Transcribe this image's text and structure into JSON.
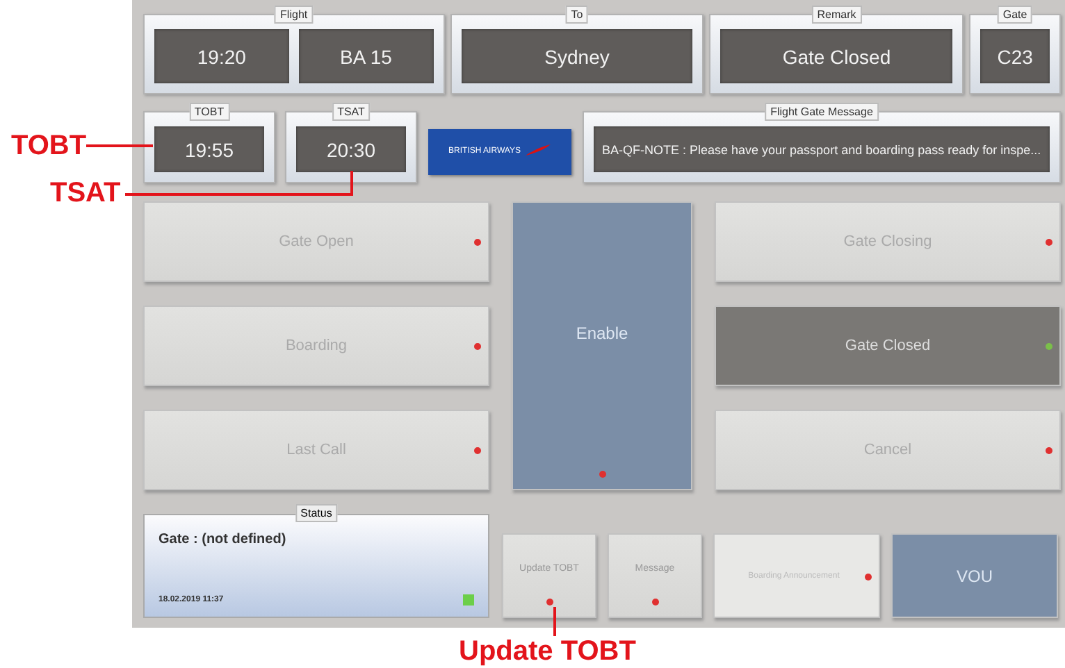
{
  "header_fields": [
    {
      "label": "Flight",
      "values": [
        "19:20",
        "BA 15"
      ]
    },
    {
      "label": "To",
      "values": [
        "Sydney"
      ]
    },
    {
      "label": "Remark",
      "values": [
        "Gate Closed"
      ]
    },
    {
      "label": "Gate",
      "values": [
        "C23"
      ]
    }
  ],
  "time_fields": [
    {
      "label": "TOBT",
      "value": "19:55"
    },
    {
      "label": "TSAT",
      "value": "20:30"
    }
  ],
  "airline_logo": {
    "text": "BRITISH AIRWAYS"
  },
  "message": {
    "label": "Flight Gate Message",
    "value": "BA-QF-NOTE : Please have your passport and boarding pass ready for inspe..."
  },
  "gate_buttons": [
    {
      "label": "Gate Open",
      "active": false
    },
    {
      "label": "Gate Closing",
      "active": false
    },
    {
      "label": "Boarding",
      "active": false
    },
    {
      "label": "Gate Closed",
      "active": true
    },
    {
      "label": "Last Call",
      "active": false
    },
    {
      "label": "Cancel",
      "active": false
    }
  ],
  "enable_button": {
    "label": "Enable",
    "active": false
  },
  "status": {
    "label": "Status",
    "title": "Gate : (not defined)",
    "timestamp": "18.02.2019 11:37",
    "online": true
  },
  "bottom_buttons": [
    {
      "label": "Update TOBT",
      "kind": "small",
      "active": false
    },
    {
      "label": "Message",
      "kind": "small",
      "active": false
    },
    {
      "label": "Boarding Announcement",
      "kind": "wide",
      "active": false
    },
    {
      "label": "VOU",
      "kind": "primary"
    }
  ],
  "annotations": [
    {
      "text": "TOBT"
    },
    {
      "text": "TSAT"
    },
    {
      "text": "Update TOBT"
    }
  ]
}
